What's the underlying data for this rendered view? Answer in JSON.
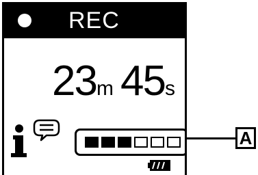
{
  "header": {
    "status_label": "REC",
    "status_icon": "record-dot-icon"
  },
  "elapsed_time": {
    "minutes": "23",
    "minutes_unit": "m",
    "seconds": "45",
    "seconds_unit": "s"
  },
  "info": {
    "icon": "info-speech-icon"
  },
  "level_meter": {
    "segments_total": 6,
    "segments_filled": 3
  },
  "battery": {
    "icon": "battery-icon",
    "level": "full"
  },
  "callout": {
    "label": "A"
  },
  "colors": {
    "background": "#ffffff",
    "foreground": "#000000"
  }
}
